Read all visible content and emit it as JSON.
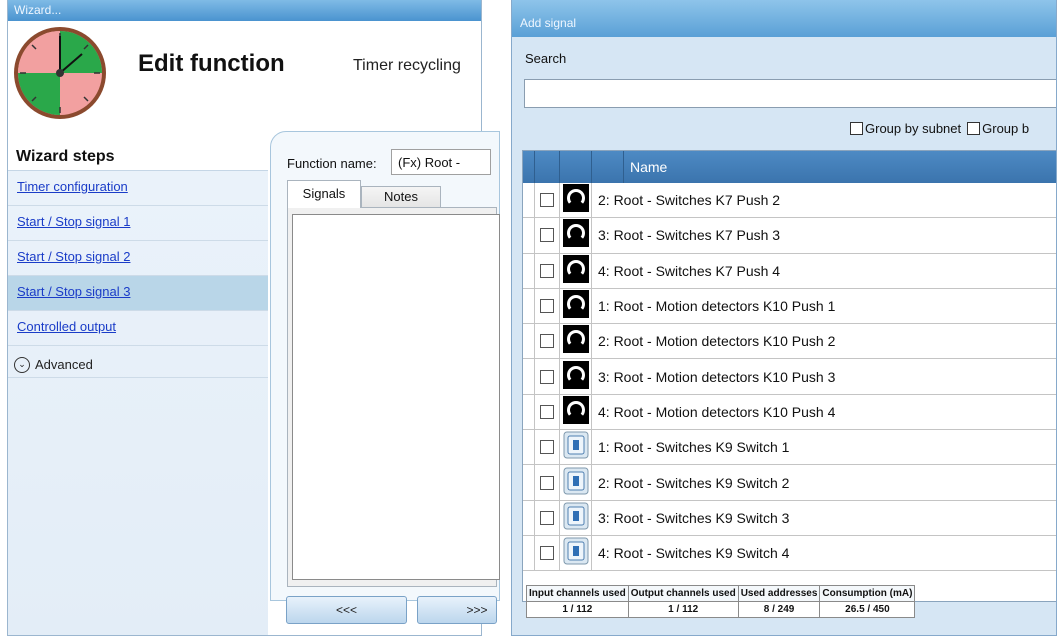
{
  "wizard": {
    "window_title": "Wizard...",
    "title": "Edit function",
    "subtitle": "Timer recycling",
    "steps_heading": "Wizard steps",
    "steps": [
      {
        "label": "Timer configuration",
        "active": false
      },
      {
        "label": "Start / Stop signal 1",
        "active": false
      },
      {
        "label": "Start / Stop signal 2",
        "active": false
      },
      {
        "label": "Start / Stop signal 3",
        "active": true
      },
      {
        "label": "Controlled output",
        "active": false
      }
    ],
    "advanced_label": "Advanced",
    "function_name_label": "Function name:",
    "function_name_value": "(Fx) Root -",
    "tabs": [
      "Signals",
      "Notes"
    ],
    "prev_button": "<<<",
    "next_button": ">>>"
  },
  "add_signal": {
    "window_title": "Add signal",
    "search_label": "Search",
    "search_value": "",
    "group_by_subnet": "Group by subnet",
    "group_by_other": "Group b",
    "column_name": "Name",
    "rows": [
      {
        "name": "2: Root - Switches K7 Push 2",
        "icon": "push-button-icon"
      },
      {
        "name": "3: Root - Switches K7 Push 3",
        "icon": "push-button-icon"
      },
      {
        "name": "4: Root - Switches K7 Push 4",
        "icon": "push-button-icon"
      },
      {
        "name": "1: Root - Motion detectors K10 Push 1",
        "icon": "push-button-icon"
      },
      {
        "name": "2: Root - Motion detectors K10 Push 2",
        "icon": "push-button-icon"
      },
      {
        "name": "3: Root - Motion detectors K10 Push 3",
        "icon": "push-button-icon"
      },
      {
        "name": "4: Root - Motion detectors K10 Push 4",
        "icon": "push-button-icon"
      },
      {
        "name": "1: Root - Switches K9 Switch 1",
        "icon": "switch-icon"
      },
      {
        "name": "2: Root - Switches K9 Switch 2",
        "icon": "switch-icon"
      },
      {
        "name": "3: Root - Switches K9 Switch 3",
        "icon": "switch-icon"
      },
      {
        "name": "4: Root - Switches K9 Switch 4",
        "icon": "switch-icon"
      }
    ],
    "usage": {
      "input_channels_label": "Input channels used",
      "input_channels_value": "1 / 112",
      "output_channels_label": "Output channels used",
      "output_channels_value": "1 / 112",
      "used_addresses_label": "Used addresses",
      "used_addresses_value": "8 / 249",
      "consumption_label": "Consumption (mA)",
      "consumption_value": "26.5 / 450"
    }
  },
  "colors": {
    "titlebar": "#5aa0d6",
    "grid_header": "#3b74ad",
    "active_step": "#b9d6e8",
    "link": "#1a3cc8"
  }
}
